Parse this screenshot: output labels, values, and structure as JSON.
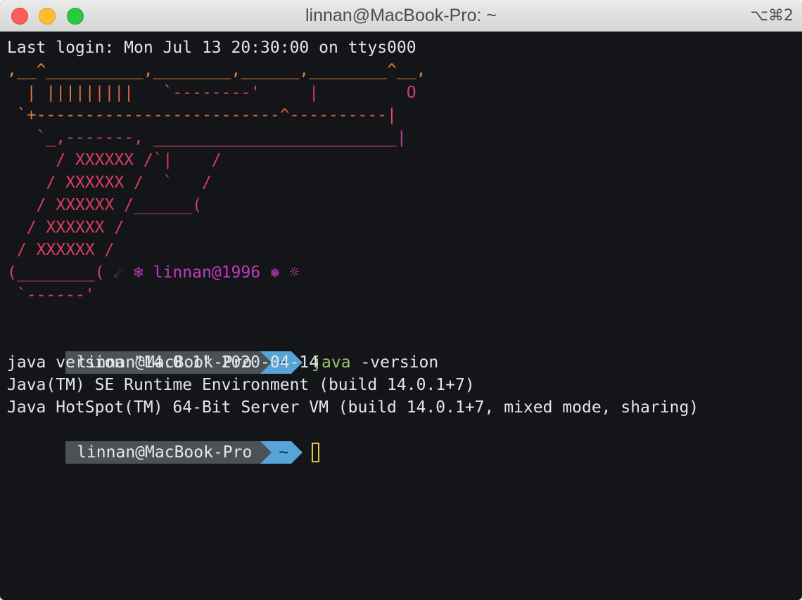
{
  "window": {
    "title": "linnan@MacBook-Pro: ~",
    "shortcut": "⌥⌘2"
  },
  "terminal": {
    "last_login": "Last login: Mon Jul 13 20:30:00 on ttys000",
    "art": [
      ",__^__________,________,______,________^__,",
      "  | |||||||||   `--------'     |         O",
      " `+-------------------------^----------|",
      "   `_,-------, _________________________|",
      "     / XXXXXX /`|    /",
      "    / XXXXXX /  `   /",
      "   / XXXXXX /______(",
      "  / XXXXXX /",
      " / XXXXXX /",
      "(________(",
      " `------'"
    ],
    "signature": "☄ ❄ linnan@1996 ❅ ☼",
    "prompt_user": "linnan@MacBook-Pro",
    "prompt_dir": "~",
    "command_name": "java",
    "command_args": " -version",
    "output": [
      "java version \"14.0.1\" 2020-04-14",
      "Java(TM) SE Runtime Environment (build 14.0.1+7)",
      "Java HotSpot(TM) 64-Bit Server VM (build 14.0.1+7, mixed mode, sharing)"
    ]
  },
  "colors": {
    "background": "#141518",
    "art_orange": "#e4812f",
    "art_pink": "#dc3c62",
    "art_purple": "#be3cbe",
    "prompt_user_bg": "#4a5258",
    "prompt_dir_bg": "#57a5d8",
    "command_green": "#98c36b",
    "cursor": "#e7c547"
  }
}
